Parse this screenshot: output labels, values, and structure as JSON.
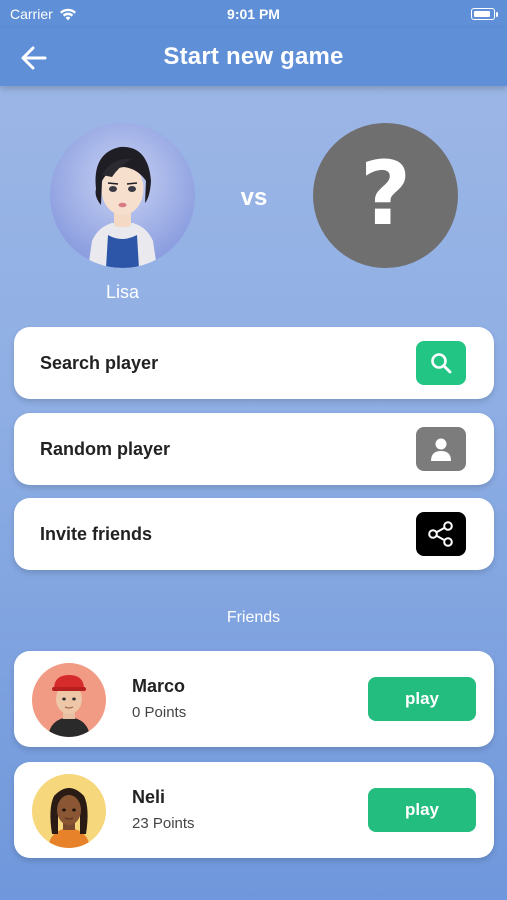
{
  "status_bar": {
    "carrier": "Carrier",
    "time": "9:01 PM",
    "battery_level": 0.9
  },
  "header": {
    "title": "Start new game",
    "back_icon": "arrow-left-icon"
  },
  "match": {
    "player_name": "Lisa",
    "vs_label": "vs",
    "opponent_placeholder": "?"
  },
  "actions": [
    {
      "label": "Search player",
      "icon": "search-icon",
      "icon_bg": "#22c584"
    },
    {
      "label": "Random player",
      "icon": "user-icon",
      "icon_bg": "#7c7c7c"
    },
    {
      "label": "Invite friends",
      "icon": "share-icon",
      "icon_bg": "#000000"
    }
  ],
  "friends": {
    "title": "Friends",
    "items": [
      {
        "name": "Marco",
        "points": "0 Points",
        "play_label": "play"
      },
      {
        "name": "Neli",
        "points": "23 Points",
        "play_label": "play"
      }
    ]
  },
  "colors": {
    "header": "#5f8fd6",
    "accent_green": "#22bd7f"
  }
}
